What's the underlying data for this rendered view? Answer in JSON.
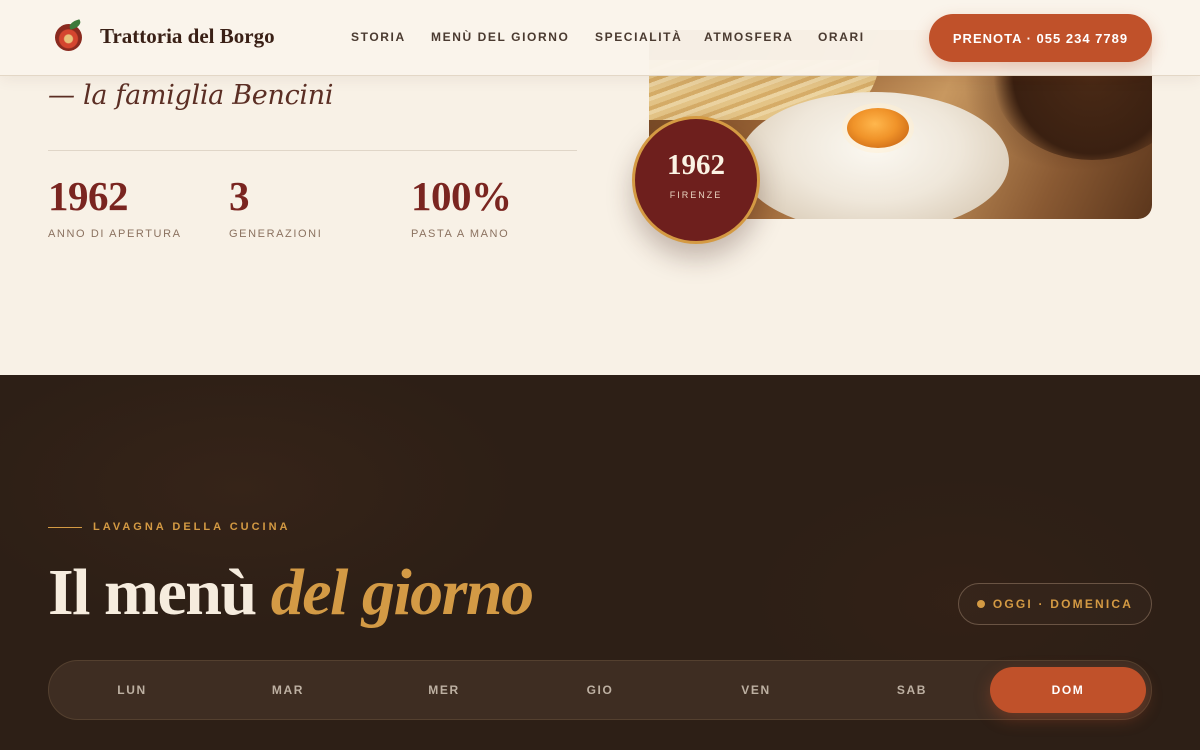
{
  "brand": {
    "name": "Trattoria del Borgo",
    "logo_icon": "tomato-pizza-icon"
  },
  "nav": {
    "links": [
      "STORIA",
      "MENÙ DEL GIORNO",
      "SPECIALITÀ",
      "ATMOSFERA",
      "ORARI"
    ],
    "cta_label": "PRENOTA · 055 234 7789"
  },
  "story": {
    "signature": "— la famiglia Bencini",
    "stats": [
      {
        "value": "1962",
        "label": "ANNO DI APERTURA"
      },
      {
        "value": "3",
        "label": "GENERAZIONI"
      },
      {
        "value": "100%",
        "label": "PASTA A MANO"
      }
    ],
    "badge": {
      "year": "1962",
      "city": "FIRENZE"
    }
  },
  "menu": {
    "eyebrow": "LAVAGNA DELLA CUCINA",
    "title_main": "Il menù",
    "title_accent": "del giorno",
    "today": "OGGI · DOMENICA",
    "days": [
      "LUN",
      "MAR",
      "MER",
      "GIO",
      "VEN",
      "SAB",
      "DOM"
    ],
    "active_day": "DOM"
  },
  "colors": {
    "accent": "#c0512a",
    "gold": "#d49a43",
    "wine": "#6e1f1d",
    "cream": "#f8f1e6",
    "dark_brown": "#2d1f16"
  }
}
